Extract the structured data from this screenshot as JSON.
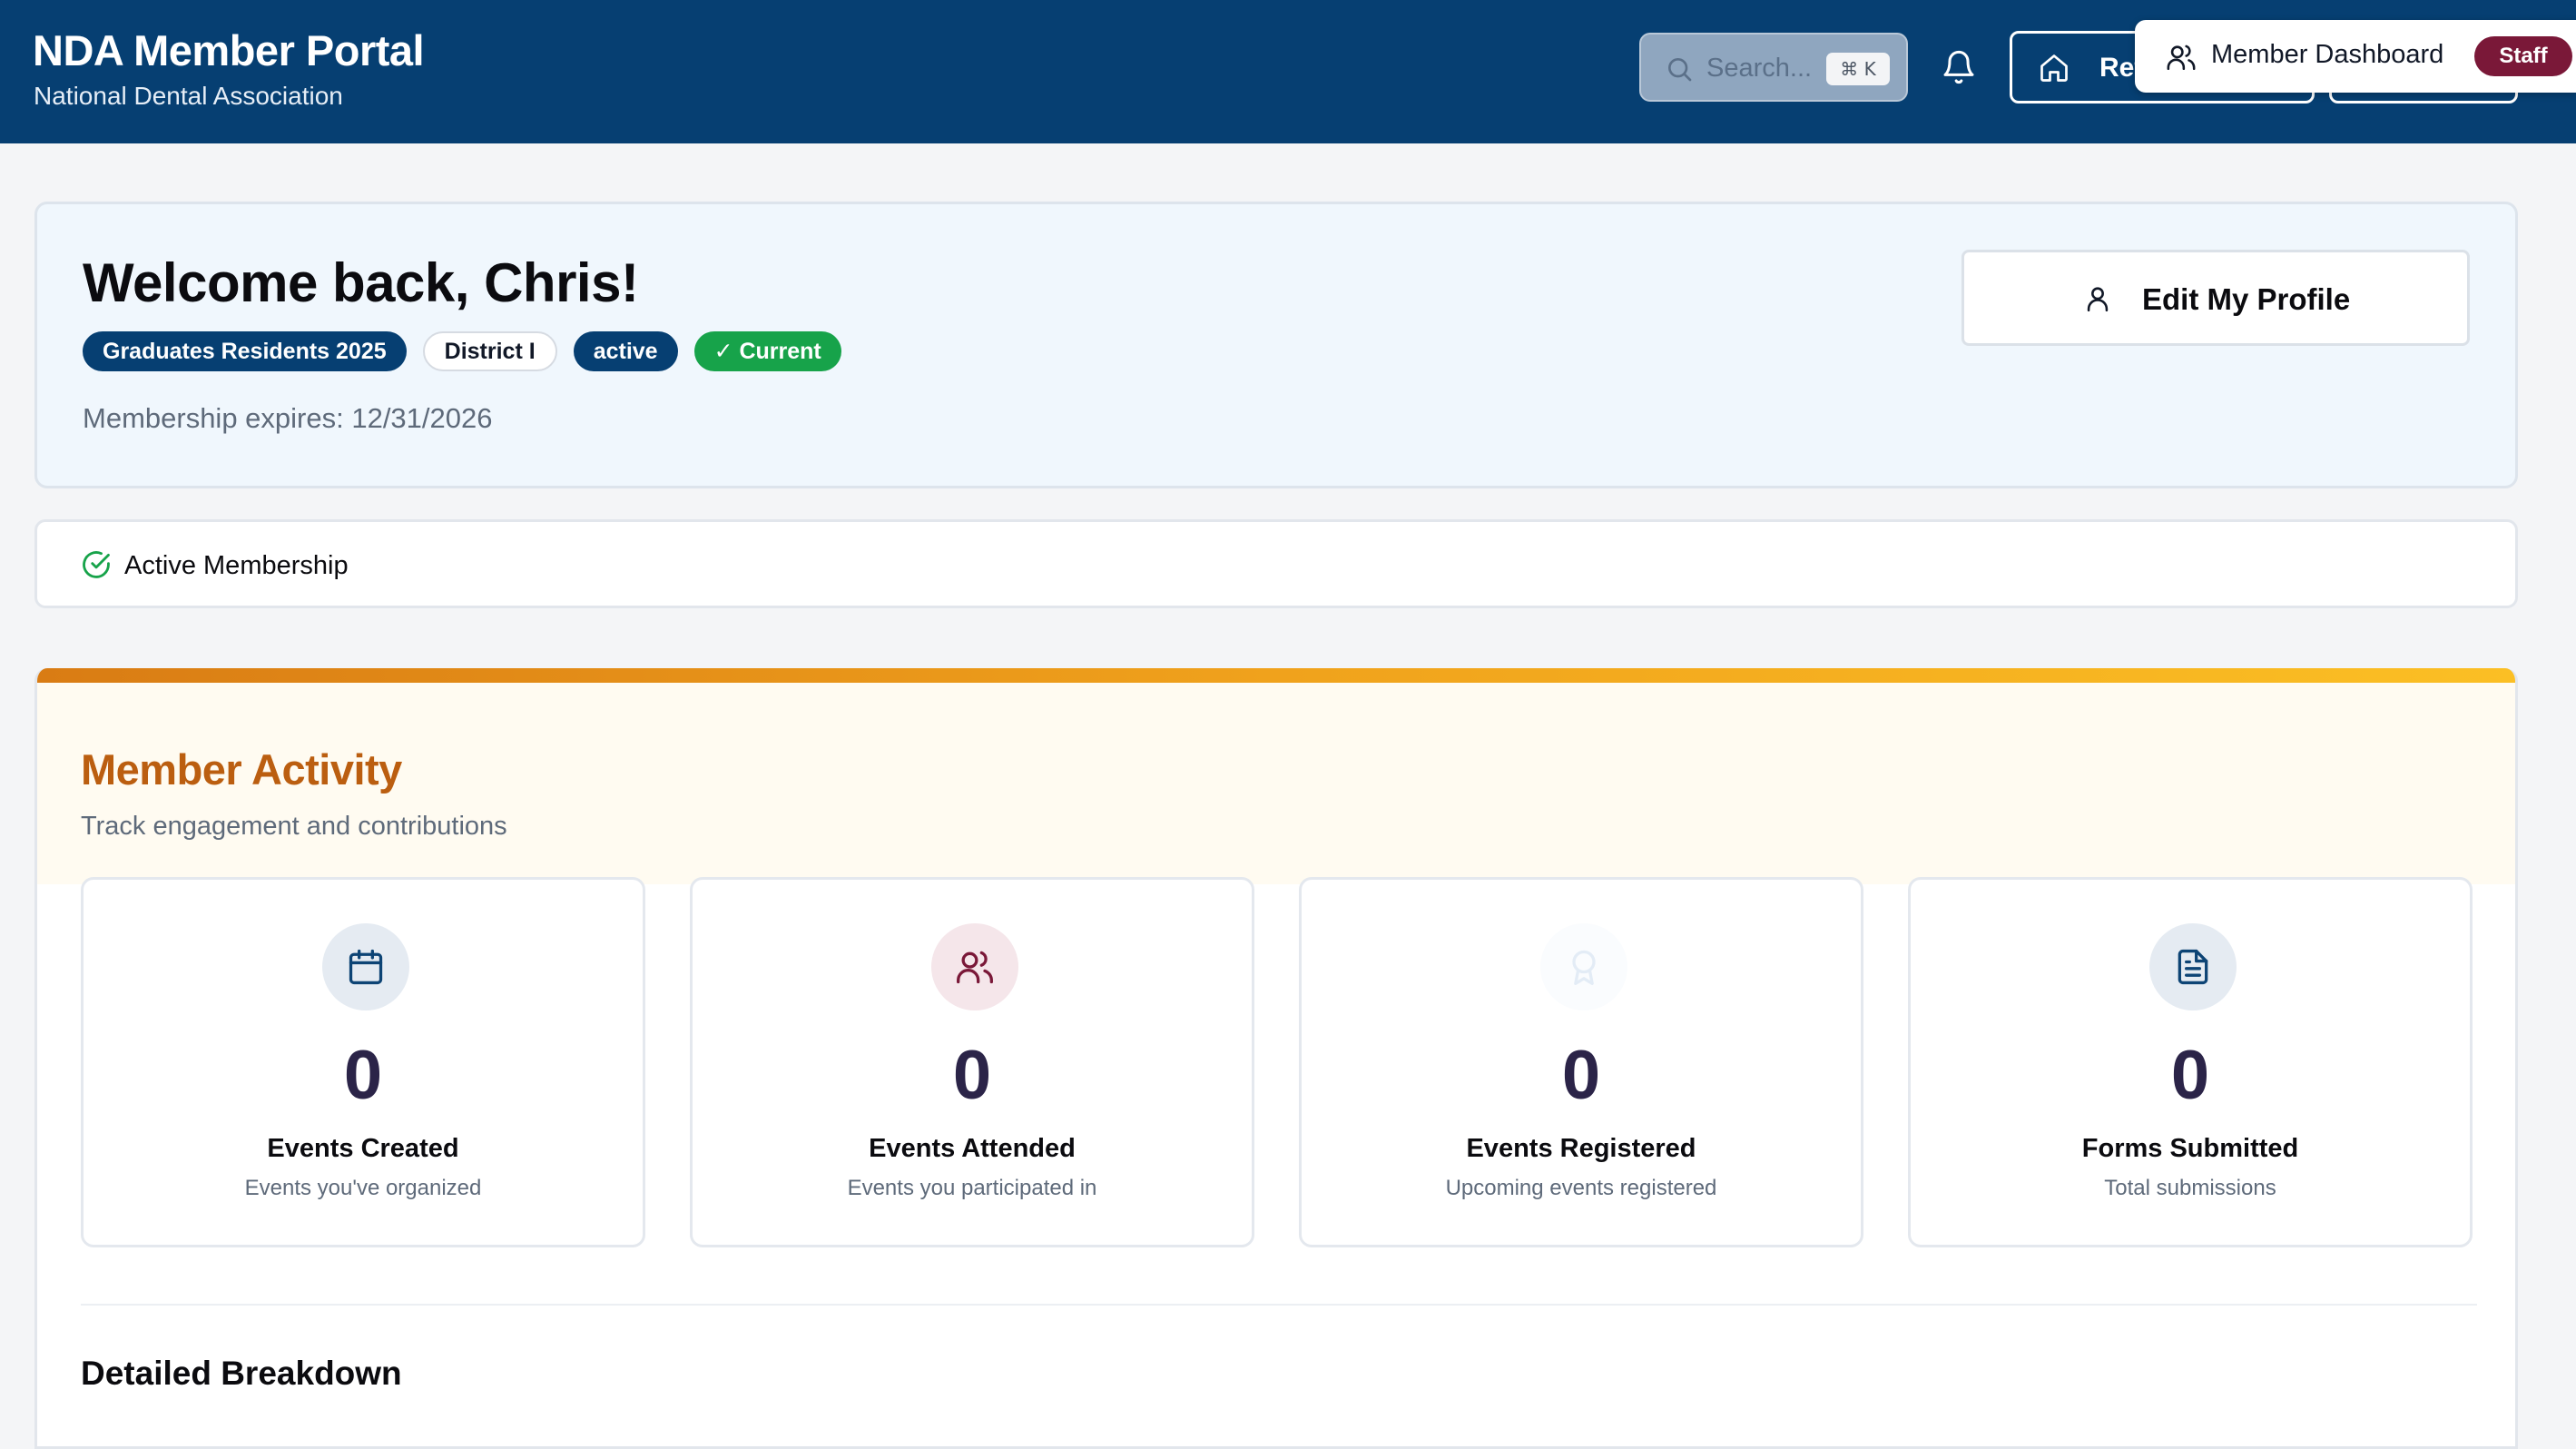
{
  "header": {
    "title": "NDA Member Portal",
    "subtitle": "National Dental Association",
    "search": {
      "placeholder": "Search...",
      "shortcut": "⌘ K"
    },
    "return_label": "Return to Portal",
    "dashboard_menu": {
      "label": "Member Dashboard",
      "badge": "Staff"
    },
    "colors": {
      "background": "#063f72",
      "staff_badge": "#7a1838"
    }
  },
  "welcome": {
    "title": "Welcome back, Chris!",
    "badges": [
      {
        "label": "Graduates Residents 2025",
        "style": "navy"
      },
      {
        "label": "District I",
        "style": "outline"
      },
      {
        "label": "active",
        "style": "navy"
      },
      {
        "label": "✓ Current",
        "style": "green"
      }
    ],
    "expires": "Membership expires: 12/31/2026",
    "edit_profile_label": "Edit My Profile"
  },
  "membership_status": {
    "label": "Active Membership",
    "icon": "check-circle-icon"
  },
  "activity": {
    "title": "Member Activity",
    "subtitle": "Track engagement and contributions",
    "accent": "#bb5e10",
    "stats": [
      {
        "icon": "calendar-icon",
        "value": "0",
        "label": "Events Created",
        "desc": "Events you've organized"
      },
      {
        "icon": "users-icon",
        "value": "0",
        "label": "Events Attended",
        "desc": "Events you participated in"
      },
      {
        "icon": "award-icon",
        "value": "0",
        "label": "Events Registered",
        "desc": "Upcoming events registered"
      },
      {
        "icon": "file-text-icon",
        "value": "0",
        "label": "Forms Submitted",
        "desc": "Total submissions"
      }
    ],
    "breakdown_title": "Detailed Breakdown"
  }
}
